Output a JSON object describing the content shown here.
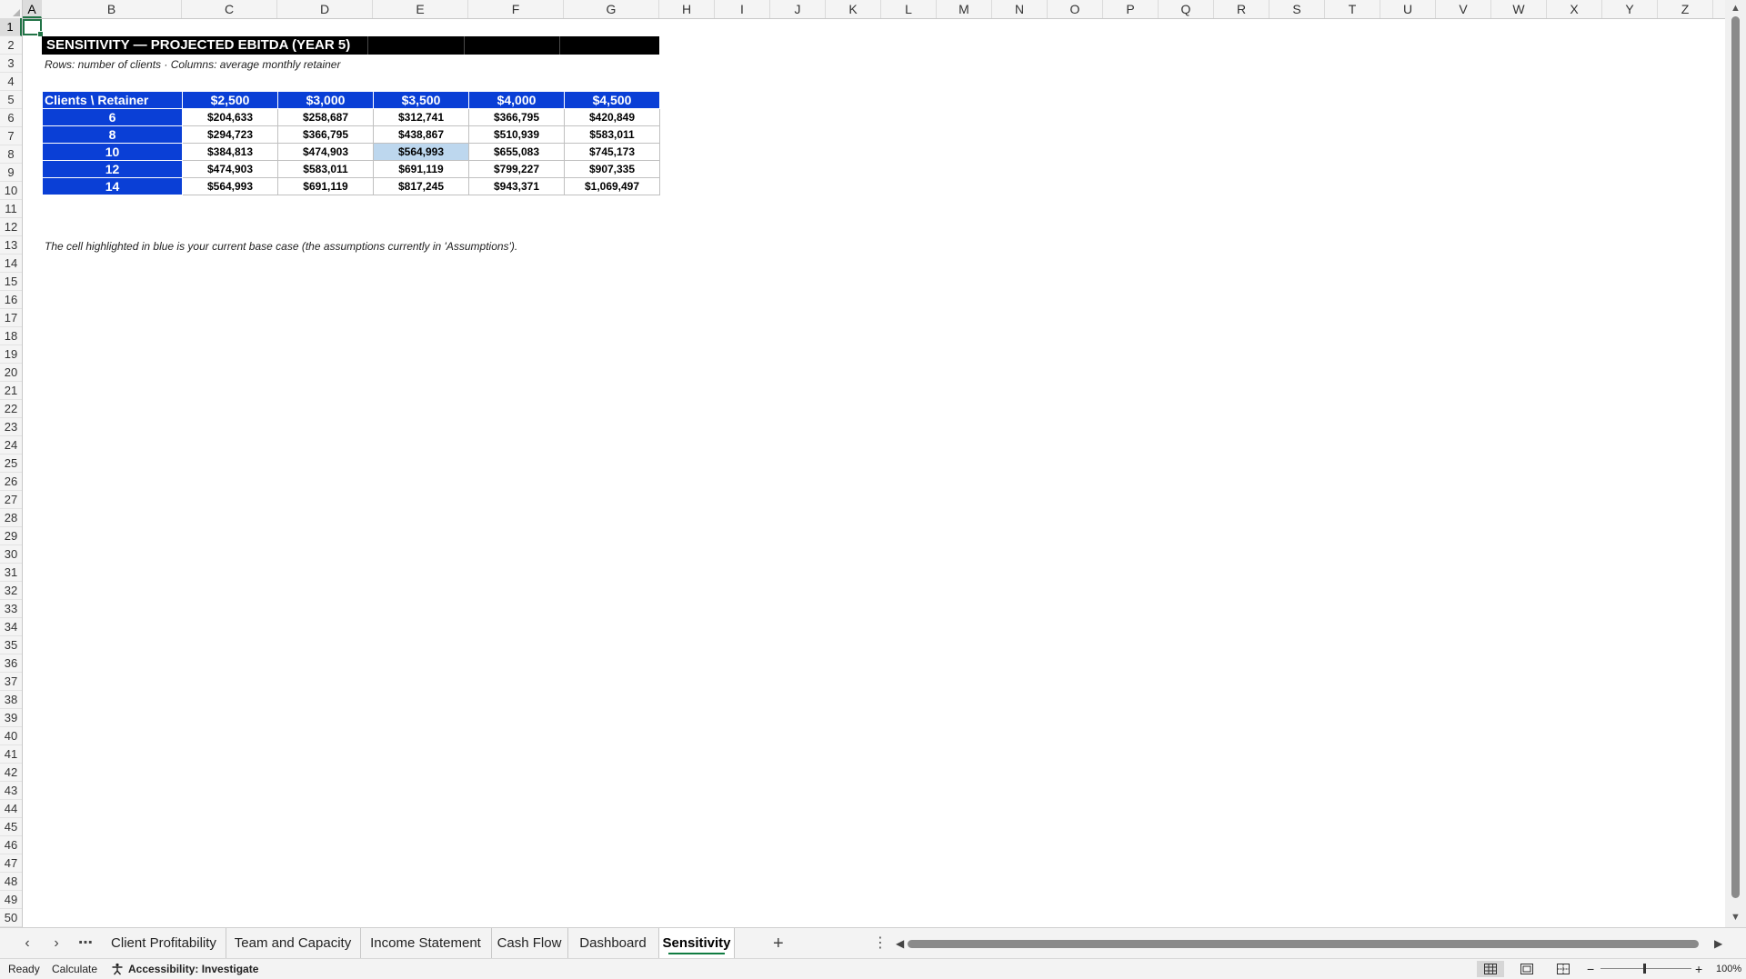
{
  "columns": [
    "A",
    "B",
    "C",
    "D",
    "E",
    "F",
    "G",
    "H",
    "I",
    "J",
    "K",
    "L",
    "M",
    "N",
    "O",
    "P",
    "Q",
    "R",
    "S",
    "T",
    "U",
    "V",
    "W",
    "X",
    "Y",
    "Z"
  ],
  "rows": [
    "1",
    "2",
    "3",
    "4",
    "5",
    "6",
    "7",
    "8",
    "9",
    "10",
    "11",
    "12",
    "13",
    "14",
    "15",
    "16",
    "17",
    "18",
    "19",
    "20",
    "21",
    "22",
    "23",
    "24",
    "25",
    "26",
    "27",
    "28",
    "29",
    "30",
    "31",
    "32",
    "33",
    "34",
    "35",
    "36",
    "37",
    "38",
    "39",
    "40",
    "41",
    "42",
    "43",
    "44",
    "45",
    "46",
    "47",
    "48",
    "49",
    "50"
  ],
  "active_cell": "A1",
  "sheet": {
    "title": "SENSITIVITY — PROJECTED EBITDA (YEAR 5)",
    "subtitle": "Rows: number of clients · Columns: average monthly retainer",
    "note": "The cell highlighted in blue is your current base case (the assumptions currently in 'Assumptions').",
    "table": {
      "corner_label": "Clients \\ Retainer",
      "col_headers": [
        "$2,500",
        "$3,000",
        "$3,500",
        "$4,000",
        "$4,500"
      ],
      "rows": [
        {
          "label": "6",
          "values": [
            "$204,633",
            "$258,687",
            "$312,741",
            "$366,795",
            "$420,849"
          ]
        },
        {
          "label": "8",
          "values": [
            "$294,723",
            "$366,795",
            "$438,867",
            "$510,939",
            "$583,011"
          ]
        },
        {
          "label": "10",
          "values": [
            "$384,813",
            "$474,903",
            "$564,993",
            "$655,083",
            "$745,173"
          ]
        },
        {
          "label": "12",
          "values": [
            "$474,903",
            "$583,011",
            "$691,119",
            "$799,227",
            "$907,335"
          ]
        },
        {
          "label": "14",
          "values": [
            "$564,993",
            "$691,119",
            "$817,245",
            "$943,371",
            "$1,069,497"
          ]
        }
      ],
      "base_case": {
        "row": 2,
        "col": 2
      },
      "header_color": "#0a3fd6",
      "base_case_color": "#bdd7ee"
    }
  },
  "tabs": {
    "items": [
      "Client Profitability",
      "Team and Capacity",
      "Income Statement",
      "Cash Flow",
      "Dashboard",
      "Sensitivity"
    ],
    "active": "Sensitivity",
    "nav_prev_icon": "chevron-left-icon",
    "nav_next_icon": "chevron-right-icon",
    "more_icon": "ellipsis-icon",
    "add_icon": "plus-icon"
  },
  "status": {
    "ready": "Ready",
    "calculate": "Calculate",
    "accessibility": "Accessibility: Investigate",
    "zoom": "100%",
    "zoom_minus": "−",
    "zoom_plus": "+"
  },
  "accent_color": "#217346"
}
